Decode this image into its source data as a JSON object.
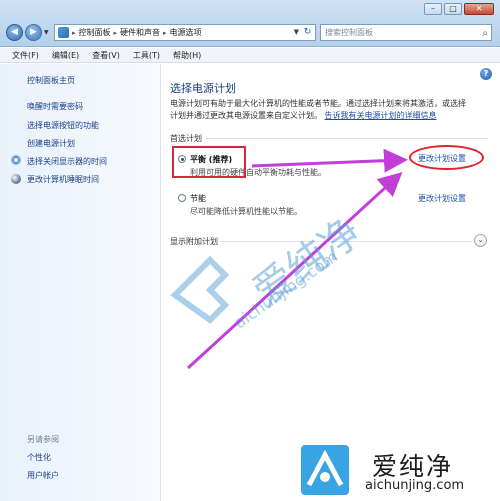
{
  "address": {
    "crumbs": [
      "控制面板",
      "硬件和声音",
      "电源选项"
    ],
    "search_placeholder": "搜索控制面板"
  },
  "menu": [
    "文件(F)",
    "编辑(E)",
    "查看(V)",
    "工具(T)",
    "帮助(H)"
  ],
  "sidebar": {
    "home": "控制面板主页",
    "items": [
      "唤醒时需要密码",
      "选择电源按钮的功能",
      "创建电源计划",
      "选择关闭显示器的时间",
      "更改计算机睡眠时间"
    ],
    "see_also_title": "另请参阅",
    "see_also": [
      "个性化",
      "用户帐户"
    ]
  },
  "main": {
    "title": "选择电源计划",
    "desc_line1": "电源计划可有助于最大化计算机的性能或者节能。通过选择计划来将其激活，或选择",
    "desc_line2": "计划并通过更改其电源设置来自定义计划。",
    "desc_link": "告诉我有关电源计划的详细信息",
    "preferred_group": "首选计划",
    "plans": [
      {
        "name": "平衡 (推荐)",
        "desc": "利用可用的硬件自动平衡功耗与性能。",
        "change": "更改计划设置",
        "checked": true
      },
      {
        "name": "节能",
        "desc": "尽可能降低计算机性能以节能。",
        "change": "更改计划设置",
        "checked": false
      }
    ],
    "more_plans": "显示附加计划"
  },
  "watermark": {
    "brand": "爱纯净",
    "site": "aichunjing.com",
    "colors": {
      "logo": "#3aa3e3",
      "arrow": "#c13fd8",
      "highlight": "#e0222f"
    }
  }
}
